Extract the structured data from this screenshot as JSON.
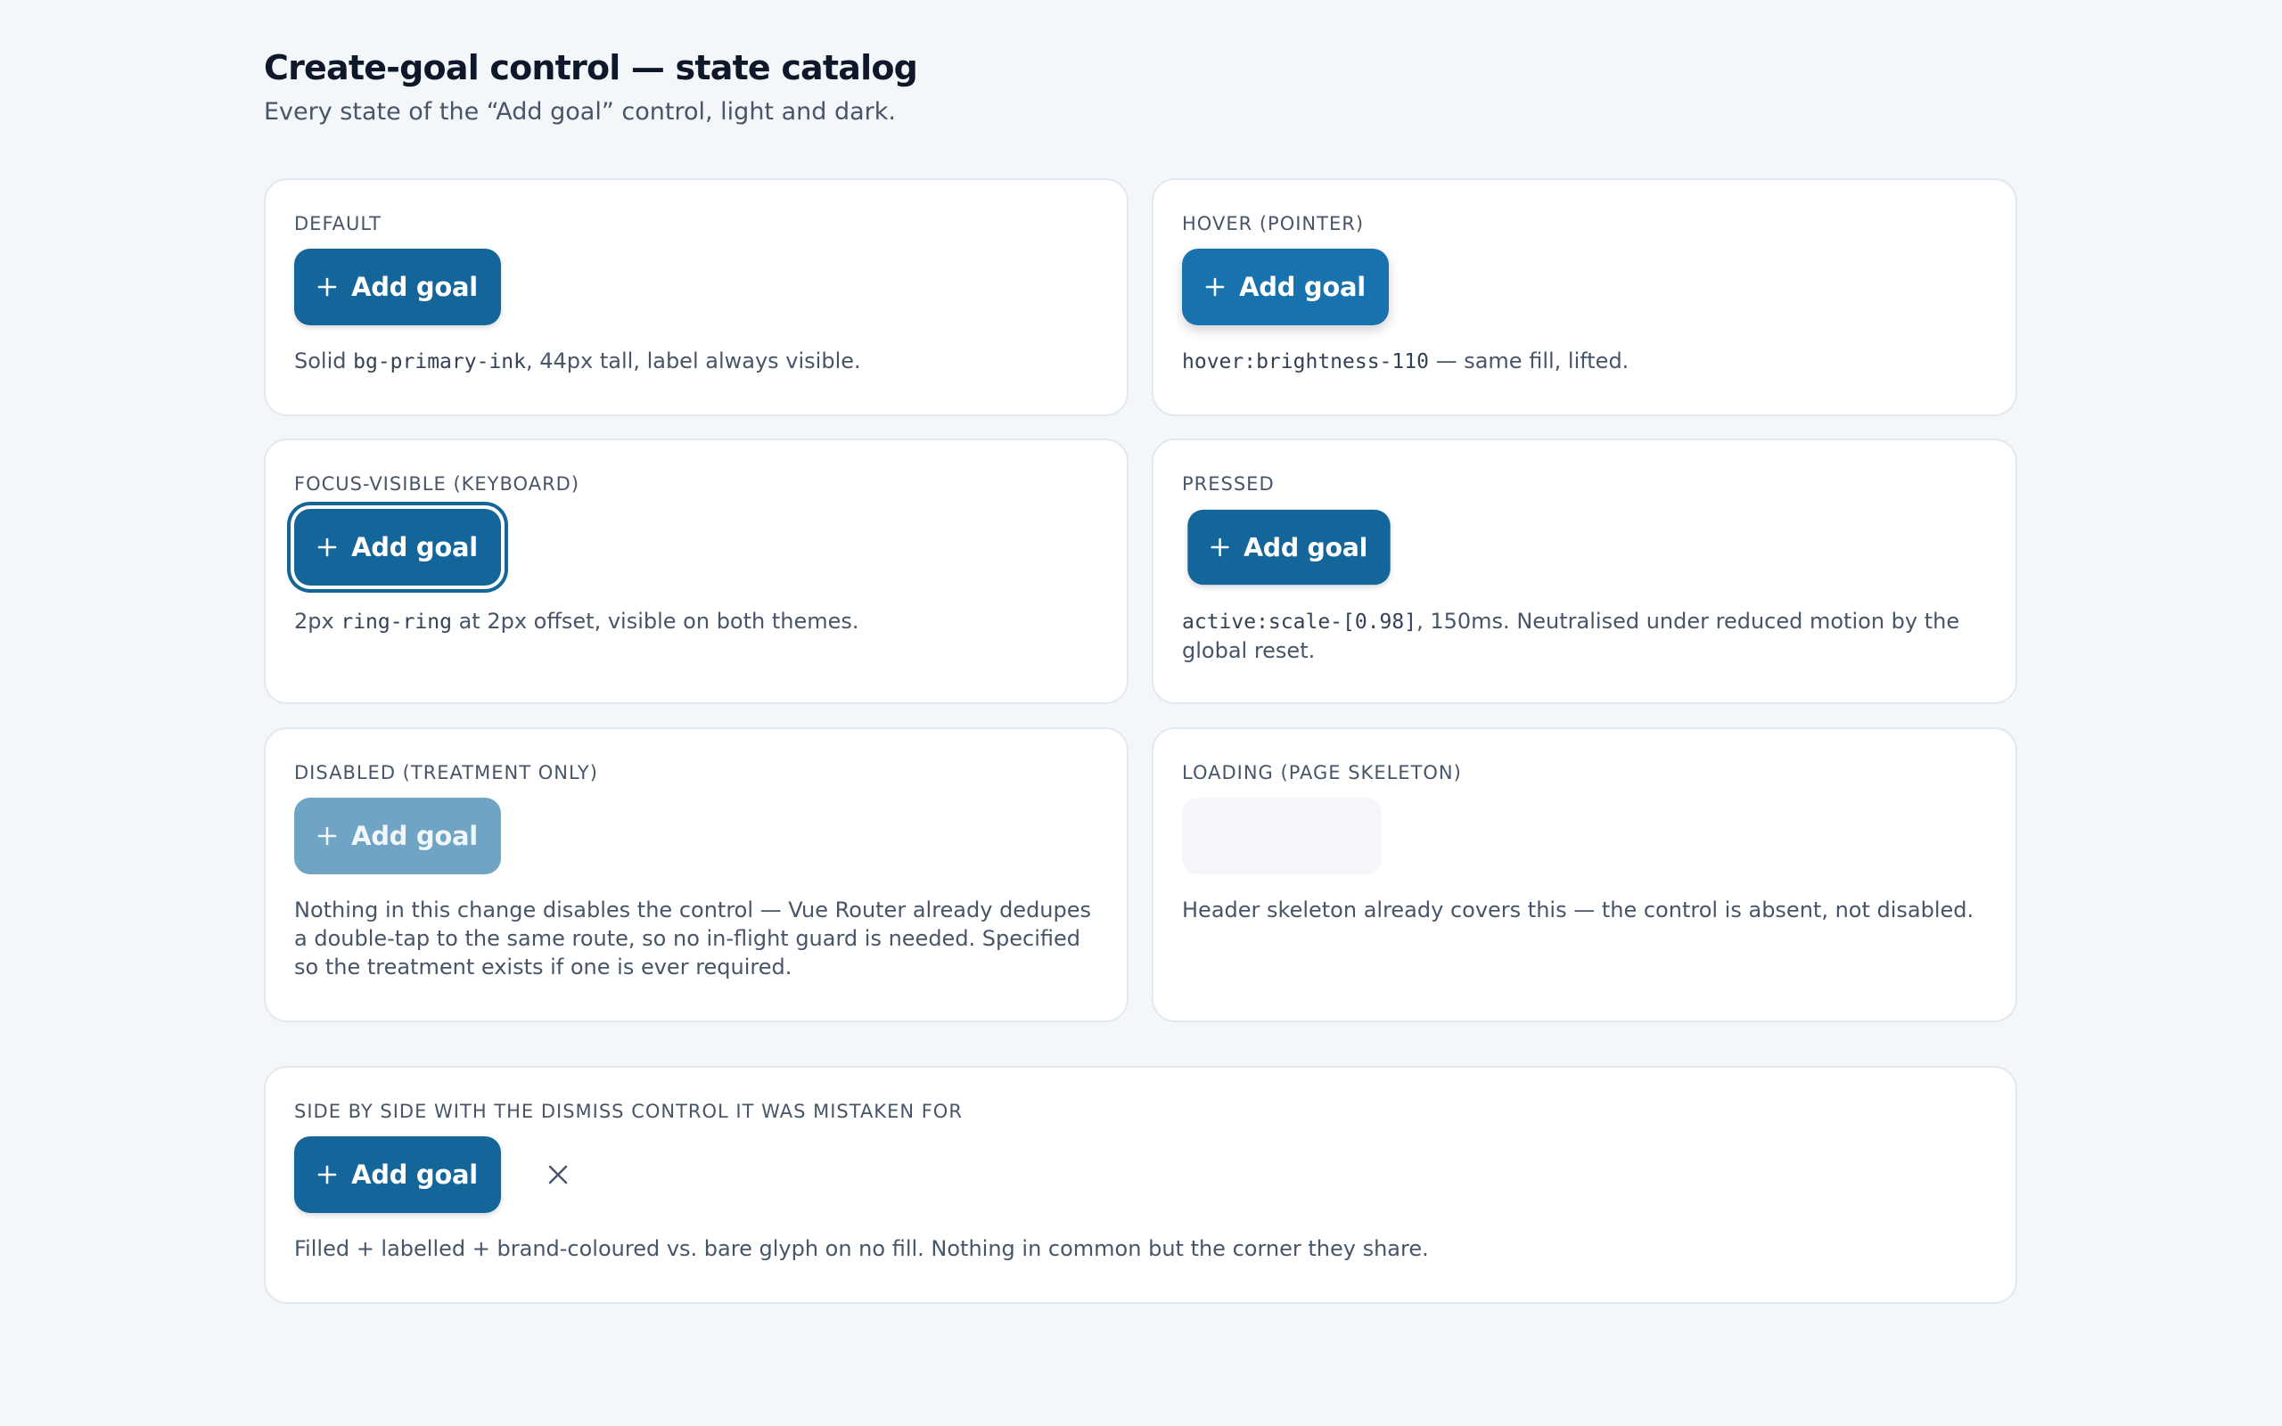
{
  "header": {
    "title": "Create-goal control — state catalog",
    "subtitle": "Every state of the “Add goal” control, light and dark."
  },
  "button": {
    "label": "Add goal",
    "icon": "plus-icon",
    "color": "#13659a"
  },
  "cards": {
    "default": {
      "label": "DEFAULT",
      "desc_pre": "Solid ",
      "desc_code": "bg-primary-ink",
      "desc_post": ", 44px tall, label always visible."
    },
    "hover": {
      "label": "HOVER (POINTER)",
      "desc_code": "hover:brightness-110",
      "desc_post": " — same fill, lifted."
    },
    "focus": {
      "label": "FOCUS-VISIBLE (KEYBOARD)",
      "desc_pre": "2px ",
      "desc_code": "ring-ring",
      "desc_post": " at 2px offset, visible on both themes."
    },
    "pressed": {
      "label": "PRESSED",
      "desc_code": "active:scale-[0.98]",
      "desc_post": ", 150ms. Neutralised under reduced motion by the global reset."
    },
    "disabled": {
      "label": "DISABLED (TREATMENT ONLY)",
      "desc": "Nothing in this change disables the control — Vue Router already dedupes a double-tap to the same route, so no in-flight guard is needed. Specified so the treatment exists if one is ever required."
    },
    "loading": {
      "label": "LOADING (PAGE SKELETON)",
      "desc": "Header skeleton already covers this — the control is absent, not disabled."
    },
    "comparison": {
      "label": "SIDE BY SIDE WITH THE DISMISS CONTROL IT WAS MISTAKEN FOR",
      "dismiss_icon": "close-icon",
      "desc": "Filled + labelled + brand-coloured vs. bare glyph on no fill. Nothing in common but the corner they share."
    }
  }
}
